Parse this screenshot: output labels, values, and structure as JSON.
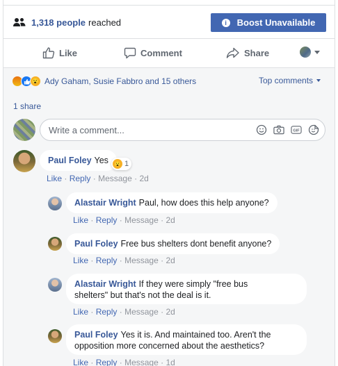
{
  "reach": {
    "count": "1,318 people",
    "suffix": "reached"
  },
  "boost": {
    "label": "Boost Unavailable"
  },
  "actions": {
    "like": "Like",
    "comment": "Comment",
    "share": "Share"
  },
  "reactions": {
    "names": "Ady Gaham, Susie Fabbro and 15 others",
    "sort": "Top comments"
  },
  "shares": "1 share",
  "composer": {
    "placeholder": "Write a comment..."
  },
  "comments": [
    {
      "author": "Paul Foley",
      "text": "Yes",
      "reaction_count": "1",
      "actions": {
        "like": "Like",
        "reply": "Reply",
        "message": "Message",
        "time": "2d"
      }
    },
    {
      "author": "Alastair Wright",
      "text": "Paul, how does this help anyone?",
      "actions": {
        "like": "Like",
        "reply": "Reply",
        "message": "Message",
        "time": "2d"
      }
    },
    {
      "author": "Paul Foley",
      "text": "Free bus shelters dont benefit anyone?",
      "actions": {
        "like": "Like",
        "reply": "Reply",
        "message": "Message",
        "time": "2d"
      }
    },
    {
      "author": "Alastair Wright",
      "text": "If they were simply \"free bus",
      "text2": "shelters\" but that's not the deal is it.",
      "actions": {
        "like": "Like",
        "reply": "Reply",
        "message": "Message",
        "time": "2d"
      }
    },
    {
      "author": "Paul Foley",
      "text": "Yes it is. And maintained too. Aren't the",
      "text2": "opposition more concerned about the aesthetics?",
      "actions": {
        "like": "Like",
        "reply": "Reply",
        "message": "Message",
        "time": "1d"
      }
    }
  ],
  "separator": "·"
}
